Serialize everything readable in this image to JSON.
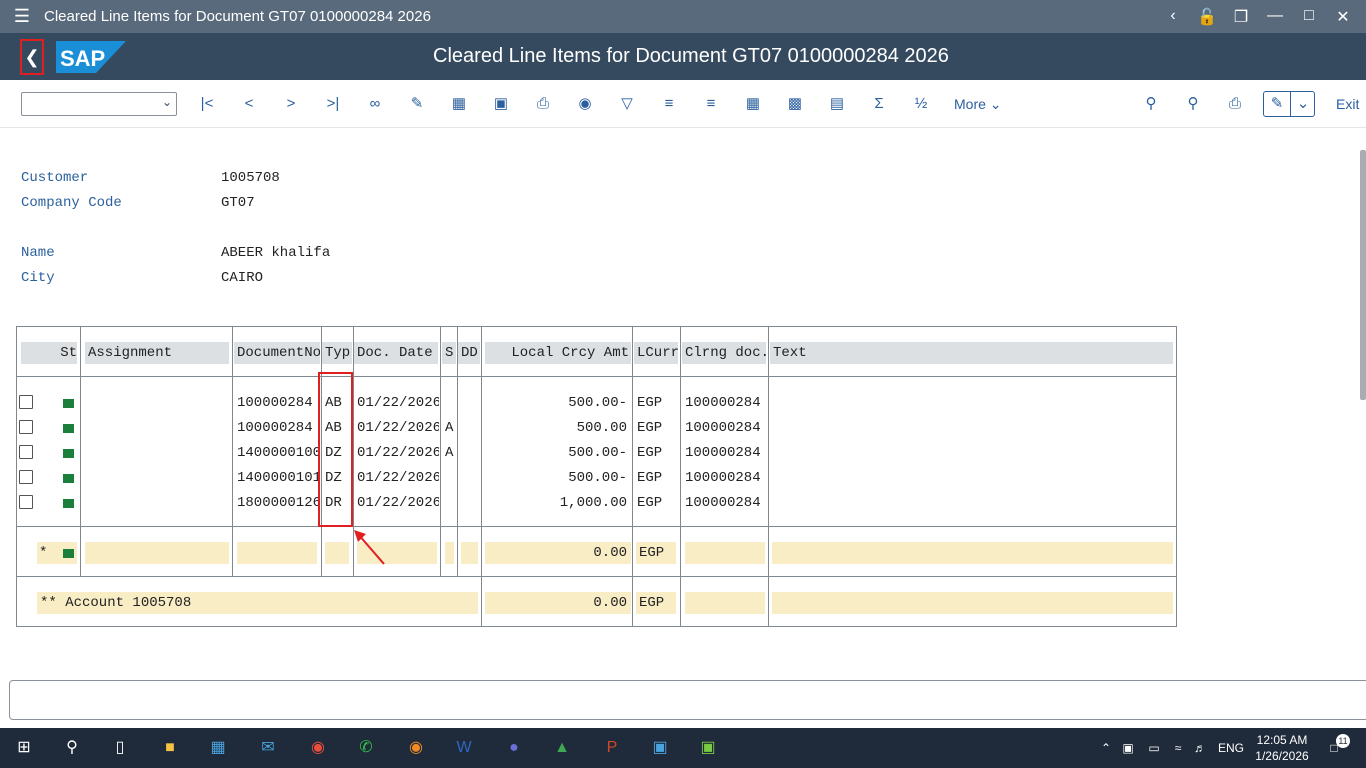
{
  "window": {
    "title": "Cleared Line Items for Document GT07 0100000284 2026"
  },
  "shell": {
    "header": "Cleared Line Items for Document GT07 0100000284 2026",
    "logo": "SAP"
  },
  "toolbar": {
    "more_label": "More",
    "exit_label": "Exit",
    "icons": [
      "first-page-icon",
      "previous-page-icon",
      "next-page-icon",
      "last-page-icon",
      "glasses-icon",
      "pencil-icon",
      "columns-icon",
      "display-icon",
      "export-icon",
      "globe-icon",
      "filter-icon",
      "sort-asc-icon",
      "sort-desc-icon",
      "grid-icon",
      "layout-icon",
      "table-icon",
      "sum-icon",
      "subtotal-icon",
      "search-icon",
      "search-plus-icon",
      "print-icon"
    ]
  },
  "header_fields": [
    {
      "label": "Customer",
      "value": "1005708"
    },
    {
      "label": "Company Code",
      "value": "GT07"
    },
    {
      "label": "Name",
      "value": "ABEER khalifa"
    },
    {
      "label": "City",
      "value": "CAIRO"
    }
  ],
  "table": {
    "columns": [
      "St",
      "Assignment",
      "DocumentNo",
      "Typ",
      "Doc. Date",
      "S",
      "DD",
      "Local Crcy Amt",
      "LCurr",
      "Clrng doc.",
      "Text"
    ],
    "rows": [
      {
        "assignment": "",
        "docno": "100000284",
        "typ": "AB",
        "date": "01/22/2026",
        "s": "",
        "dd": "",
        "amt": "500.00-",
        "curr": "EGP",
        "clrng": "100000284",
        "text": ""
      },
      {
        "assignment": "",
        "docno": "100000284",
        "typ": "AB",
        "date": "01/22/2026",
        "s": "A",
        "dd": "",
        "amt": "500.00",
        "curr": "EGP",
        "clrng": "100000284",
        "text": ""
      },
      {
        "assignment": "",
        "docno": "1400000100",
        "typ": "DZ",
        "date": "01/22/2026",
        "s": "A",
        "dd": "",
        "amt": "500.00-",
        "curr": "EGP",
        "clrng": "100000284",
        "text": ""
      },
      {
        "assignment": "",
        "docno": "1400000101",
        "typ": "DZ",
        "date": "01/22/2026",
        "s": "",
        "dd": "",
        "amt": "500.00-",
        "curr": "EGP",
        "clrng": "100000284",
        "text": ""
      },
      {
        "assignment": "",
        "docno": "1800000126",
        "typ": "DR",
        "date": "01/22/2026",
        "s": "",
        "dd": "",
        "amt": "1,000.00",
        "curr": "EGP",
        "clrng": "100000284",
        "text": ""
      }
    ],
    "subtotal": {
      "marker": "*",
      "amt": "0.00",
      "curr": "EGP"
    },
    "total": {
      "label": "** Account 1005708",
      "amt": "0.00",
      "curr": "EGP"
    }
  },
  "taskbar": {
    "lang": "ENG",
    "time": "12:05 AM",
    "date": "1/26/2026",
    "notif": "11"
  },
  "colors": {
    "shell": "#354a5f",
    "titlebar": "#596a7c",
    "link": "#2b5f9e",
    "highlight": "#e02020",
    "total_row": "#f9edc6",
    "status": "#1a7f3a"
  }
}
